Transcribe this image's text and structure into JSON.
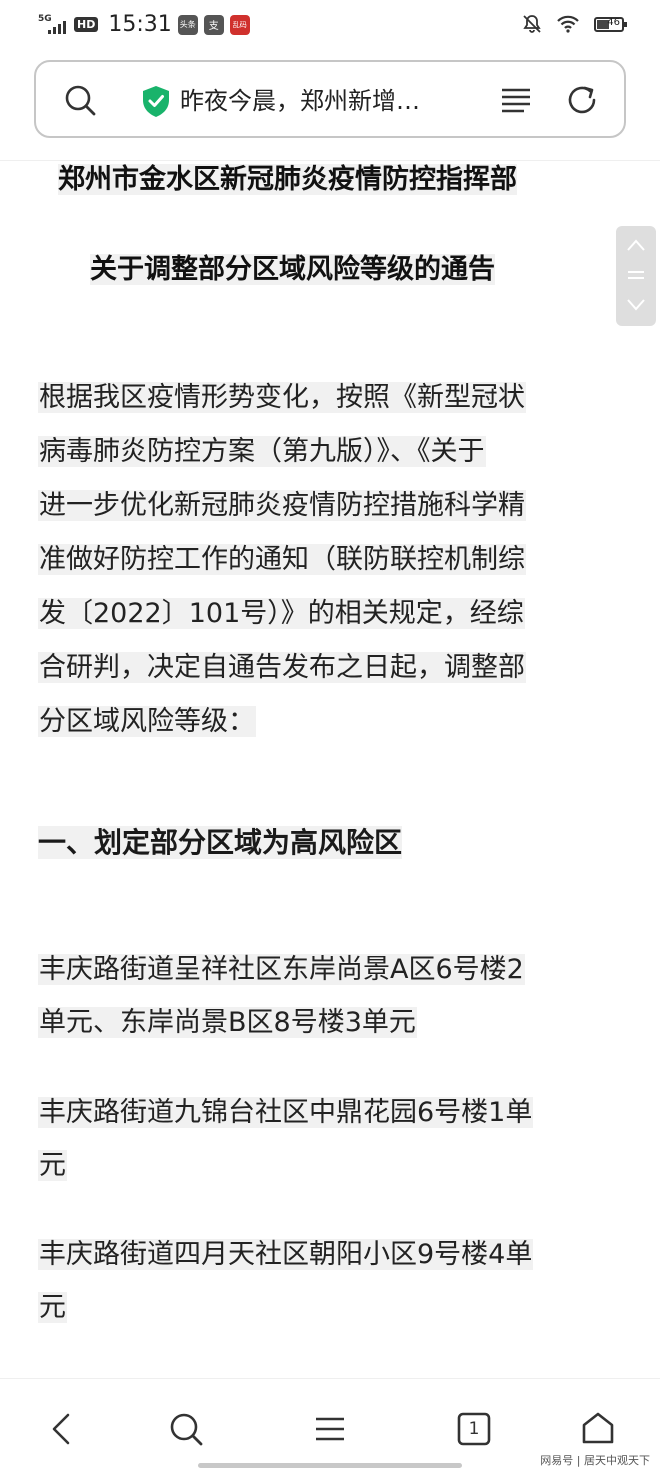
{
  "status_bar": {
    "network": "5G",
    "hd": "HD",
    "time": "15:31",
    "apps": [
      {
        "label": "头条",
        "color": "#555555"
      },
      {
        "label": "支",
        "color": "#555555"
      },
      {
        "label": "乱码",
        "color": "#d0312d"
      }
    ],
    "battery": "46"
  },
  "search_bar": {
    "url_text": "昨夜今晨，郑州新增…",
    "secure_color": "#19b36b"
  },
  "article": {
    "title_line1": "郑州市金水区新冠肺炎疫情防控指挥部",
    "title_line2": "关于调整部分区域风险等级的通告",
    "intro_lines": [
      "根据我区疫情形势变化，按照《新型冠状",
      "病毒肺炎防控方案（第九版）》、《关于",
      "进一步优化新冠肺炎疫情防控措施科学精",
      "准做好防控工作的通知（联防联控机制综",
      "发〔2022〕101号）》的相关规定，经综",
      "合研判，决定自通告发布之日起，调整部",
      "分区域风险等级："
    ],
    "section_heading": "一、划定部分区域为高风险区",
    "items": [
      [
        "丰庆路街道呈祥社区东岸尚景A区6号楼2",
        "单元、东岸尚景B区8号楼3单元"
      ],
      [
        "丰庆路街道九锦台社区中鼎花园6号楼1单",
        "元"
      ],
      [
        "丰庆路街道四月天社区朝阳小区9号楼4单",
        "元"
      ]
    ]
  },
  "bottom_nav": {
    "tab_count": "1"
  },
  "watermark": "网易号 | 居天中观天下"
}
